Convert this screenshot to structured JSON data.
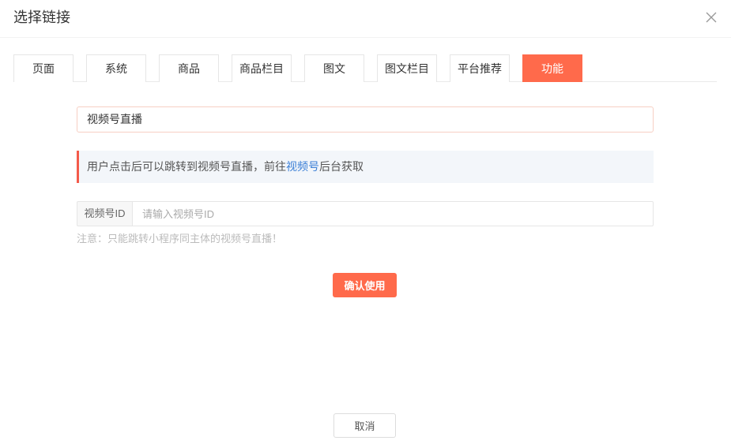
{
  "dialog": {
    "title": "选择链接",
    "close_icon": "close-icon"
  },
  "tabs": [
    {
      "label": "页面",
      "active": false
    },
    {
      "label": "系统",
      "active": false
    },
    {
      "label": "商品",
      "active": false
    },
    {
      "label": "商品栏目",
      "active": false
    },
    {
      "label": "图文",
      "active": false
    },
    {
      "label": "图文栏目",
      "active": false
    },
    {
      "label": "平台推荐",
      "active": false
    },
    {
      "label": "功能",
      "active": true
    }
  ],
  "function_select": {
    "value": "视频号直播"
  },
  "alert": {
    "text_before": "用户点击后可以跳转到视频号直播，前往",
    "link": "视频号",
    "text_after": "后台获取"
  },
  "id_field": {
    "label": "视频号ID",
    "placeholder": "请输入视频号ID",
    "value": ""
  },
  "note": "注意：只能跳转小程序同主体的视频号直播！",
  "confirm_label": "确认使用",
  "cancel_label": "取消",
  "colors": {
    "accent": "#ff6a4b",
    "link": "#3b7fd6",
    "alert_bg": "#f3f6fa",
    "alert_bar": "#f45a4a",
    "select_border": "#f7cfc3"
  }
}
